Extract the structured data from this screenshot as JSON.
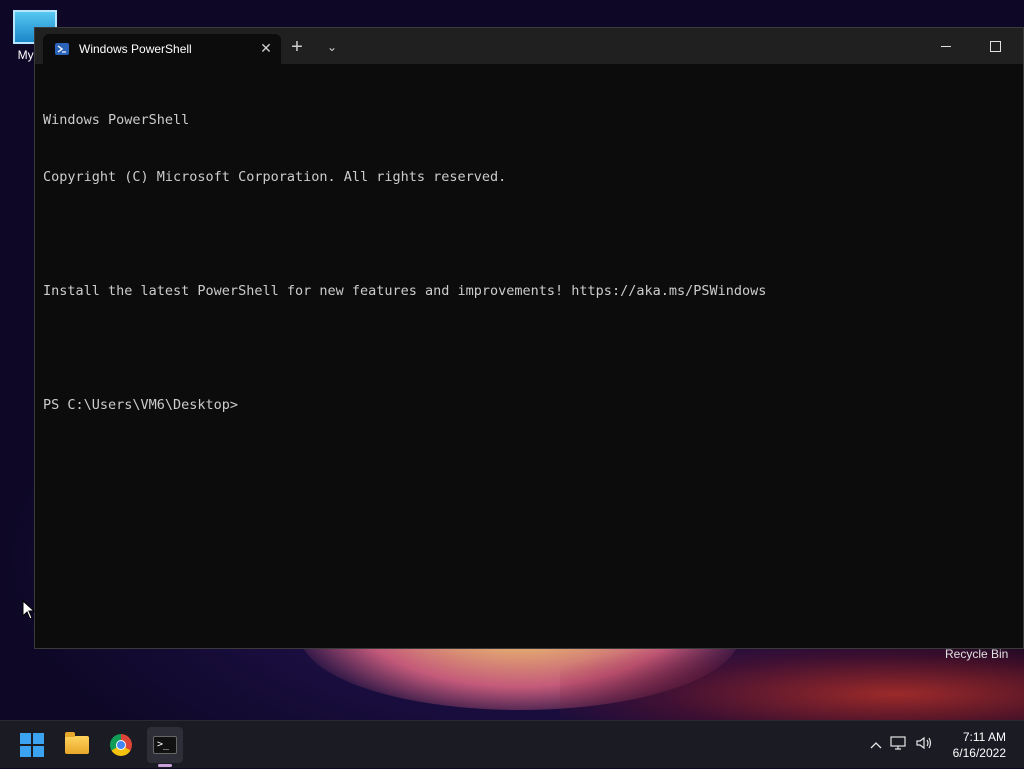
{
  "desktop": {
    "icons": [
      {
        "label": "My Co"
      },
      {
        "label": "Recycle Bin"
      }
    ]
  },
  "terminal": {
    "tab_title": "Windows PowerShell",
    "new_tab_symbol": "+",
    "dropdown_symbol": "⌄",
    "close_symbol": "✕",
    "lines": [
      "Windows PowerShell",
      "Copyright (C) Microsoft Corporation. All rights reserved.",
      "",
      "Install the latest PowerShell for new features and improvements! https://aka.ms/PSWindows",
      "",
      "PS C:\\Users\\VM6\\Desktop>"
    ]
  },
  "taskbar": {
    "apps": [
      "start-icon",
      "file-explorer-icon",
      "chrome-icon",
      "terminal-icon"
    ],
    "tray_caret": "^",
    "time": "7:11 AM",
    "date": "6/16/2022"
  },
  "colors": {
    "console_bg": "#0c0c0c",
    "console_text": "#cccccc",
    "titlebar": "#202020",
    "taskbar": "#1b1b24"
  }
}
